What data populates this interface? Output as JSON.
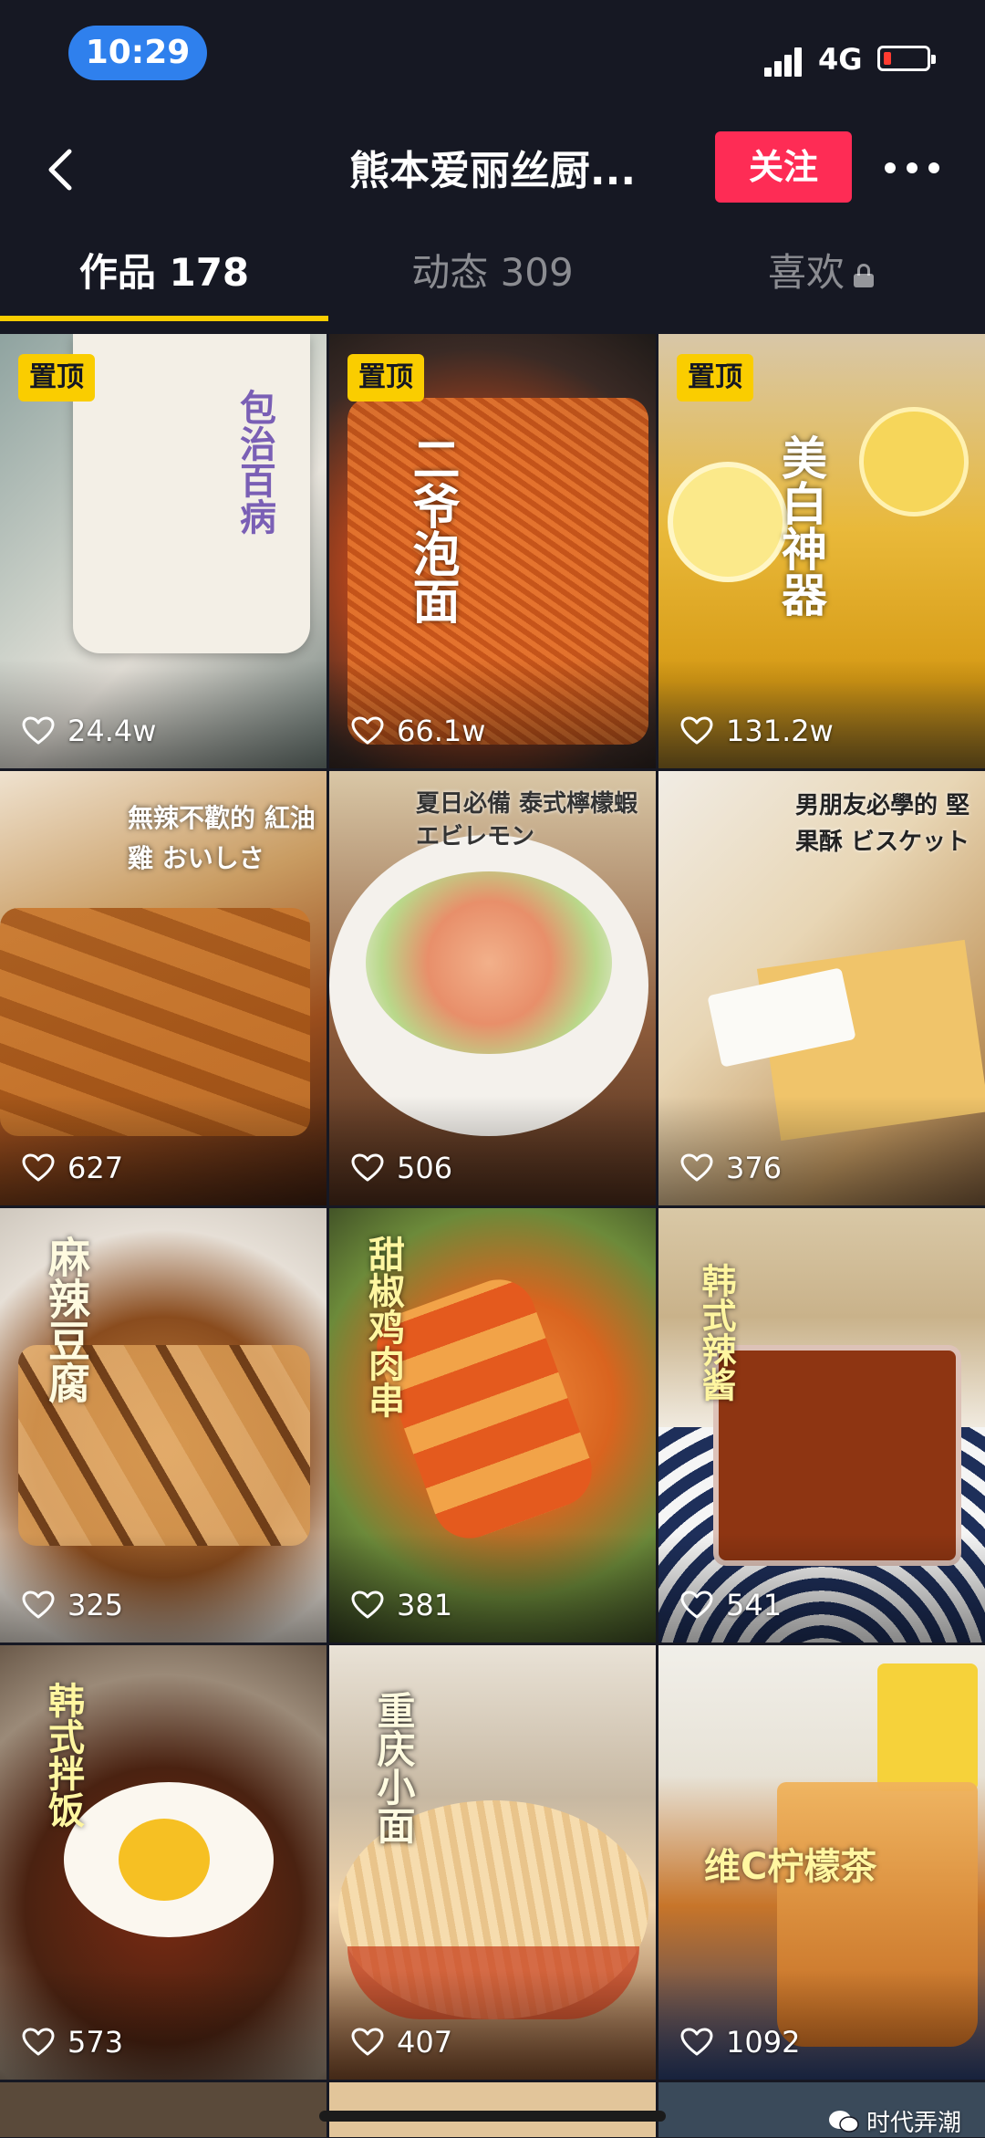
{
  "status_bar": {
    "time": "10:29",
    "network": "4G"
  },
  "nav": {
    "title": "熊本爱丽丝厨...",
    "follow_label": "关注"
  },
  "tabs": [
    {
      "label": "作品 178"
    },
    {
      "label": "动态 309"
    },
    {
      "label": "喜欢"
    }
  ],
  "pinned_label": "置顶",
  "videos": [
    {
      "likes": "24.4w",
      "overlay": "包治百病",
      "pinned": true
    },
    {
      "likes": "66.1w",
      "overlay": "二爷泡面",
      "pinned": true
    },
    {
      "likes": "131.2w",
      "overlay": "美白神器",
      "pinned": true
    },
    {
      "likes": "627",
      "overlay": "無辣不歡的 紅油雞 おいしさ"
    },
    {
      "likes": "506",
      "overlay": "夏日必備 泰式檸檬蝦 エビレモン"
    },
    {
      "likes": "376",
      "overlay": "男朋友必學的 堅果酥 ビスケット"
    },
    {
      "likes": "325",
      "overlay": "麻辣豆腐"
    },
    {
      "likes": "381",
      "overlay": "甜椒鸡肉串"
    },
    {
      "likes": "541",
      "overlay": "韩式辣酱"
    },
    {
      "likes": "573",
      "overlay": "韩式拌饭"
    },
    {
      "likes": "407",
      "overlay": "重庆小面"
    },
    {
      "likes": "1092",
      "overlay": "维C柠檬茶"
    }
  ],
  "watermark": "时代弄潮",
  "colors": {
    "background": "#161823",
    "accent": "#fe2c55",
    "tab_underline": "#facd00",
    "pin": "#facd00"
  }
}
